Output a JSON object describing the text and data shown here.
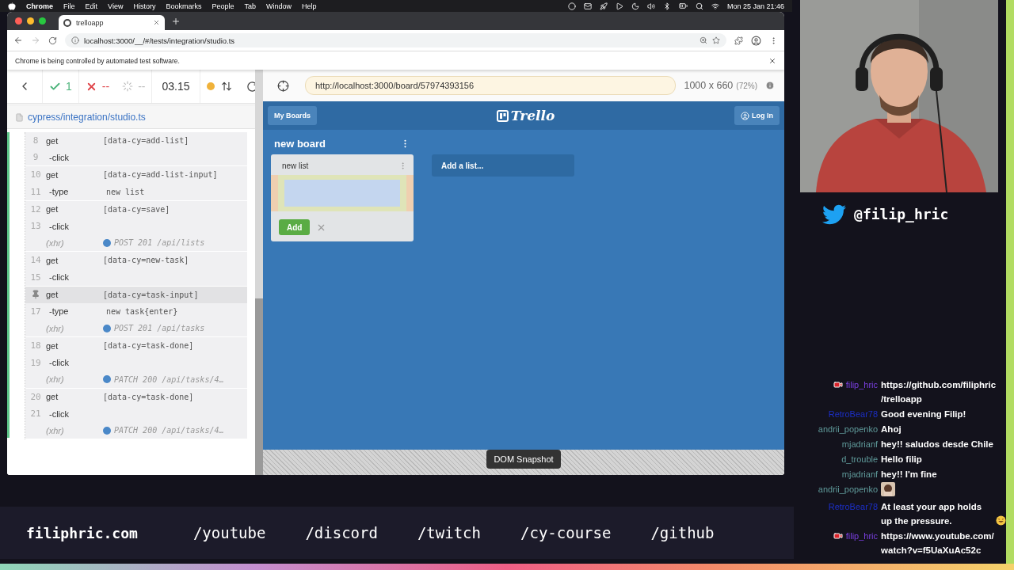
{
  "menubar": {
    "app": "Chrome",
    "menus": [
      "File",
      "Edit",
      "View",
      "History",
      "Bookmarks",
      "People",
      "Tab",
      "Window",
      "Help"
    ],
    "clock": "Mon 25 Jan  21:46"
  },
  "browser": {
    "tab_title": "trelloapp",
    "url": "localhost:3000/__/#/tests/integration/studio.ts",
    "infobar": "Chrome is being controlled by automated test software."
  },
  "reporter": {
    "passed": "1",
    "failed": "--",
    "pending": "--",
    "duration": "03.15",
    "spec": "cypress/integration/studio.ts",
    "groups": [
      {
        "rows": [
          {
            "num": "8",
            "cmd": "get",
            "arg": "[data-cy=add-list]",
            "kind": "command",
            "pinned": false
          },
          {
            "num": "9",
            "cmd": "-click",
            "kind": "command",
            "pinned": false
          }
        ]
      },
      {
        "rows": [
          {
            "num": "10",
            "cmd": "get",
            "arg": "[data-cy=add-list-input]",
            "kind": "command",
            "pinned": false
          },
          {
            "num": "11",
            "cmd": "-type",
            "arg": "new list",
            "kind": "command",
            "pinned": false
          }
        ]
      },
      {
        "rows": [
          {
            "num": "12",
            "cmd": "get",
            "arg": "[data-cy=save]",
            "kind": "command",
            "pinned": false
          },
          {
            "num": "13",
            "cmd": "-click",
            "kind": "command",
            "pinned": false
          },
          {
            "cmd": "(xhr)",
            "arg": "POST 201 /api/lists",
            "kind": "xhr",
            "pinned": false
          }
        ]
      },
      {
        "rows": [
          {
            "num": "14",
            "cmd": "get",
            "arg": "[data-cy=new-task]",
            "kind": "command",
            "pinned": false
          },
          {
            "num": "15",
            "cmd": "-click",
            "kind": "command",
            "pinned": false
          }
        ]
      },
      {
        "rows": [
          {
            "cmd": "get",
            "arg": "[data-cy=task-input]",
            "kind": "command",
            "pinned": true
          },
          {
            "num": "17",
            "cmd": "-type",
            "arg": "new task{enter}",
            "kind": "command",
            "pinned": false
          },
          {
            "cmd": "(xhr)",
            "arg": "POST 201 /api/tasks",
            "kind": "xhr",
            "pinned": false
          }
        ]
      },
      {
        "rows": [
          {
            "num": "18",
            "cmd": "get",
            "arg": "[data-cy=task-done]",
            "kind": "command",
            "pinned": false
          },
          {
            "num": "19",
            "cmd": "-click",
            "kind": "command",
            "pinned": false
          },
          {
            "cmd": "(xhr)",
            "arg": "PATCH 200 /api/tasks/4…",
            "kind": "xhr",
            "pinned": false
          }
        ]
      },
      {
        "rows": [
          {
            "num": "20",
            "cmd": "get",
            "arg": "[data-cy=task-done]",
            "kind": "command",
            "pinned": false
          },
          {
            "num": "21",
            "cmd": "-click",
            "kind": "command",
            "pinned": false
          },
          {
            "cmd": "(xhr)",
            "arg": "PATCH 200 /api/tasks/4…",
            "kind": "xhr",
            "pinned": false
          }
        ]
      }
    ]
  },
  "aut": {
    "url": "http://localhost:3000/board/57974393156",
    "viewport": "1000 x 660",
    "scale": "(72%)",
    "snapshot_label": "DOM Snapshot"
  },
  "app": {
    "my_boards": "My Boards",
    "logo": "Trello",
    "login": "Log In",
    "board_title": "new board",
    "list_title": "new list",
    "add": "Add",
    "add_list": "Add a list..."
  },
  "stream": {
    "twitter": "@filip_hric",
    "chat": [
      {
        "user": "filip_hric",
        "color": "#7a3fe0",
        "badge": true,
        "kind": "text",
        "text": "https://github.com/filiphric /trelloapp",
        "laughing": false
      },
      {
        "user": "RetroBear78",
        "color": "#1c2fc8",
        "badge": false,
        "kind": "text",
        "text": "Good evening Filip!",
        "laughing": false
      },
      {
        "user": "andrii_popenko",
        "color": "#5f9a9a",
        "badge": false,
        "kind": "text",
        "text": "Ahoj",
        "laughing": false
      },
      {
        "user": "mjadrianf",
        "color": "#5f9a9a",
        "badge": false,
        "kind": "text",
        "text": "hey!! saludos desde Chile",
        "laughing": false
      },
      {
        "user": "d_trouble",
        "color": "#5f9a9a",
        "badge": false,
        "kind": "text",
        "text": "Hello filip",
        "laughing": false
      },
      {
        "user": "mjadrianf",
        "color": "#5f9a9a",
        "badge": false,
        "kind": "text",
        "text": "hey!! I'm fine",
        "laughing": false
      },
      {
        "user": "andrii_popenko",
        "color": "#5f9a9a",
        "badge": false,
        "kind": "emote",
        "laughing": false
      },
      {
        "user": "RetroBear78",
        "color": "#1c2fc8",
        "badge": false,
        "kind": "text",
        "text": "At least your app holds up the pressure.",
        "laughing": true
      },
      {
        "user": "filip_hric",
        "color": "#7a3fe0",
        "badge": true,
        "kind": "text",
        "text": "https://www.youtube.com/ watch?v=f5UaXuAc52c",
        "laughing": false
      }
    ],
    "links": [
      {
        "label": "filiphric.com",
        "kind": "site"
      },
      {
        "label": "/youtube",
        "kind": "path"
      },
      {
        "label": "/discord",
        "kind": "path"
      },
      {
        "label": "/twitch",
        "kind": "path"
      },
      {
        "label": "/cy-course",
        "kind": "path"
      },
      {
        "label": "/github",
        "kind": "path"
      }
    ]
  }
}
